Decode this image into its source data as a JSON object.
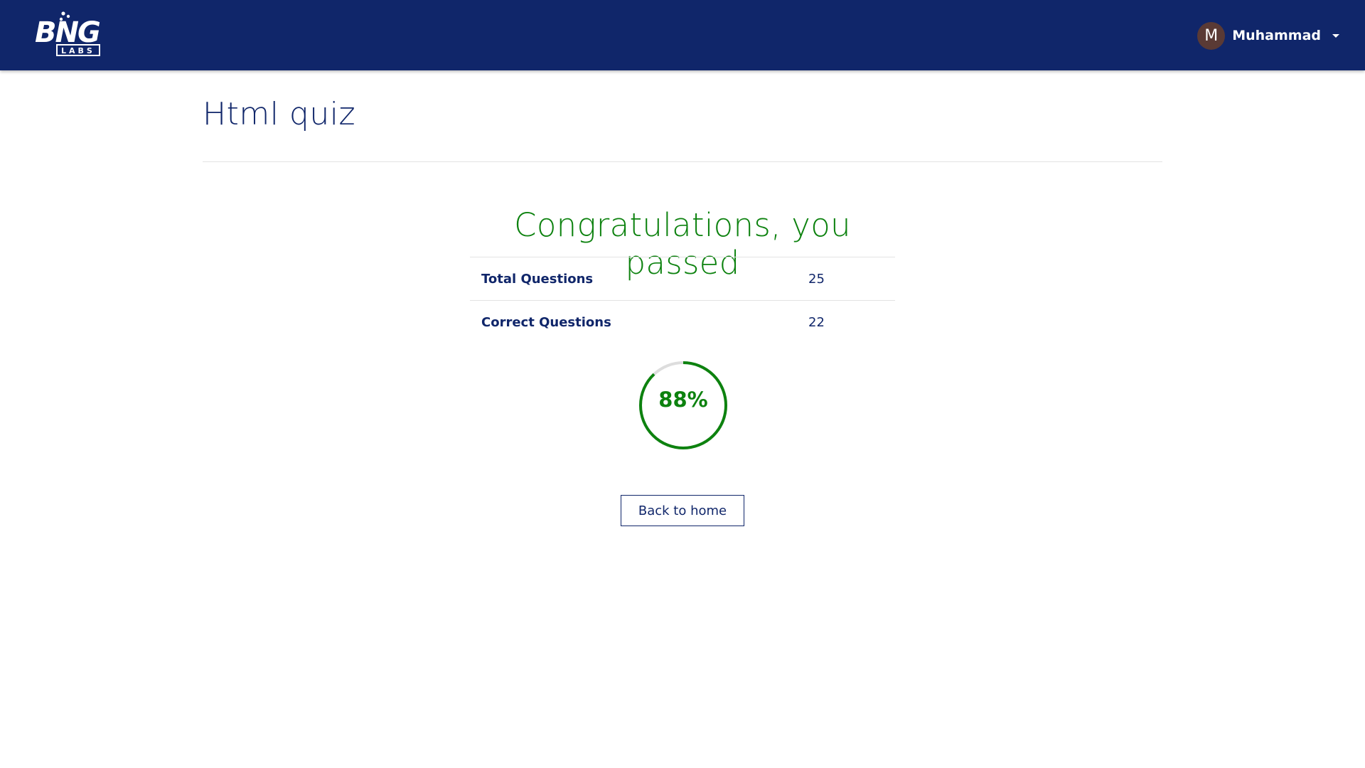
{
  "header": {
    "logo_text": "BNG",
    "logo_subtext": "LABS",
    "user": {
      "initial": "M",
      "name": "Muhammad"
    },
    "colors": {
      "background": "#10266a",
      "avatar": "#5a3a35"
    }
  },
  "page": {
    "title": "Html quiz"
  },
  "result": {
    "heading": "Congratulations, you passed",
    "rows": [
      {
        "label": "Total Questions",
        "value": "25"
      },
      {
        "label": "Correct Questions",
        "value": "22"
      }
    ],
    "score_percent": 88,
    "score_text": "88%",
    "accent_color": "#0d820f"
  },
  "actions": {
    "back_label": "Back to home"
  }
}
